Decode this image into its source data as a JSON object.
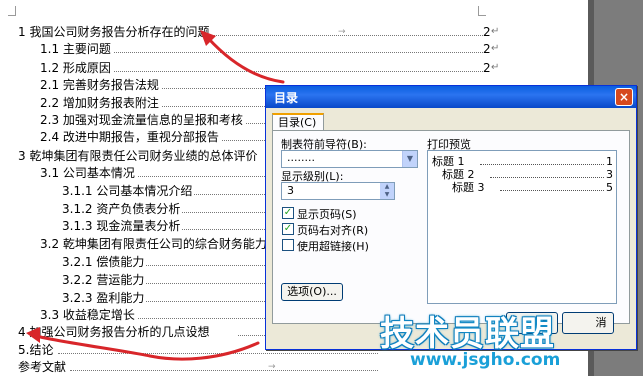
{
  "document": {
    "toc": [
      {
        "text": "1 我国公司财务报告分析存在的问题",
        "page": "2"
      },
      {
        "text": "1.1 主要问题",
        "page": "2"
      },
      {
        "text": "1.2 形成原因",
        "page": "2"
      },
      {
        "text": "2.1 完善财务报告法规",
        "page": ""
      },
      {
        "text": "2.2 增加财务报表附注",
        "page": ""
      },
      {
        "text": "2.3 加强对现金流量信息的呈报和考核",
        "page": ""
      },
      {
        "text": "2.4 改进中期报告，重视分部报告",
        "page": ""
      },
      {
        "text": "3 乾坤集团有限责任公司财务业绩的总体评价",
        "page": ""
      },
      {
        "text": "3.1 公司基本情况",
        "page": ""
      },
      {
        "text": "3.1.1 公司基本情况介绍",
        "page": ""
      },
      {
        "text": "3.1.2 资产负债表分析",
        "page": ""
      },
      {
        "text": "3.1.3 现金流量表分析",
        "page": ""
      },
      {
        "text": "3.2 乾坤集团有限责任公司的综合财务能力",
        "page": ""
      },
      {
        "text": "3.2.1 偿债能力",
        "page": ""
      },
      {
        "text": "3.2.2 营运能力",
        "page": ""
      },
      {
        "text": "3.2.3 盈利能力",
        "page": ""
      },
      {
        "text": "3.3 收益稳定增长",
        "page": ""
      },
      {
        "text": "4 加强公司财务报告分析的几点设想",
        "page": ""
      },
      {
        "text": "5.结论",
        "page": ""
      },
      {
        "text": "参考文献",
        "page": ""
      }
    ]
  },
  "dialog": {
    "title": "目录",
    "close": "×",
    "tab_label": "目录(C)",
    "leader_label": "制表符前导符(B):",
    "leader_value": "........",
    "levels_label": "显示级别(L):",
    "levels_value": "3",
    "show_page_numbers": "显示页码(S)",
    "right_align": "页码右对齐(R)",
    "use_hyperlinks": "使用超链接(H)",
    "options_button": "选项(O)...",
    "preview_label": "打印预览",
    "preview": [
      {
        "text": "标题 1",
        "page": "1"
      },
      {
        "text": "标题 2",
        "page": "3"
      },
      {
        "text": "标题 3",
        "page": "5"
      }
    ],
    "ok_fragment": "定",
    "cancel_fragment": "消"
  },
  "watermark": {
    "main": "技术员联盟",
    "url": "www.jsgho.com"
  }
}
